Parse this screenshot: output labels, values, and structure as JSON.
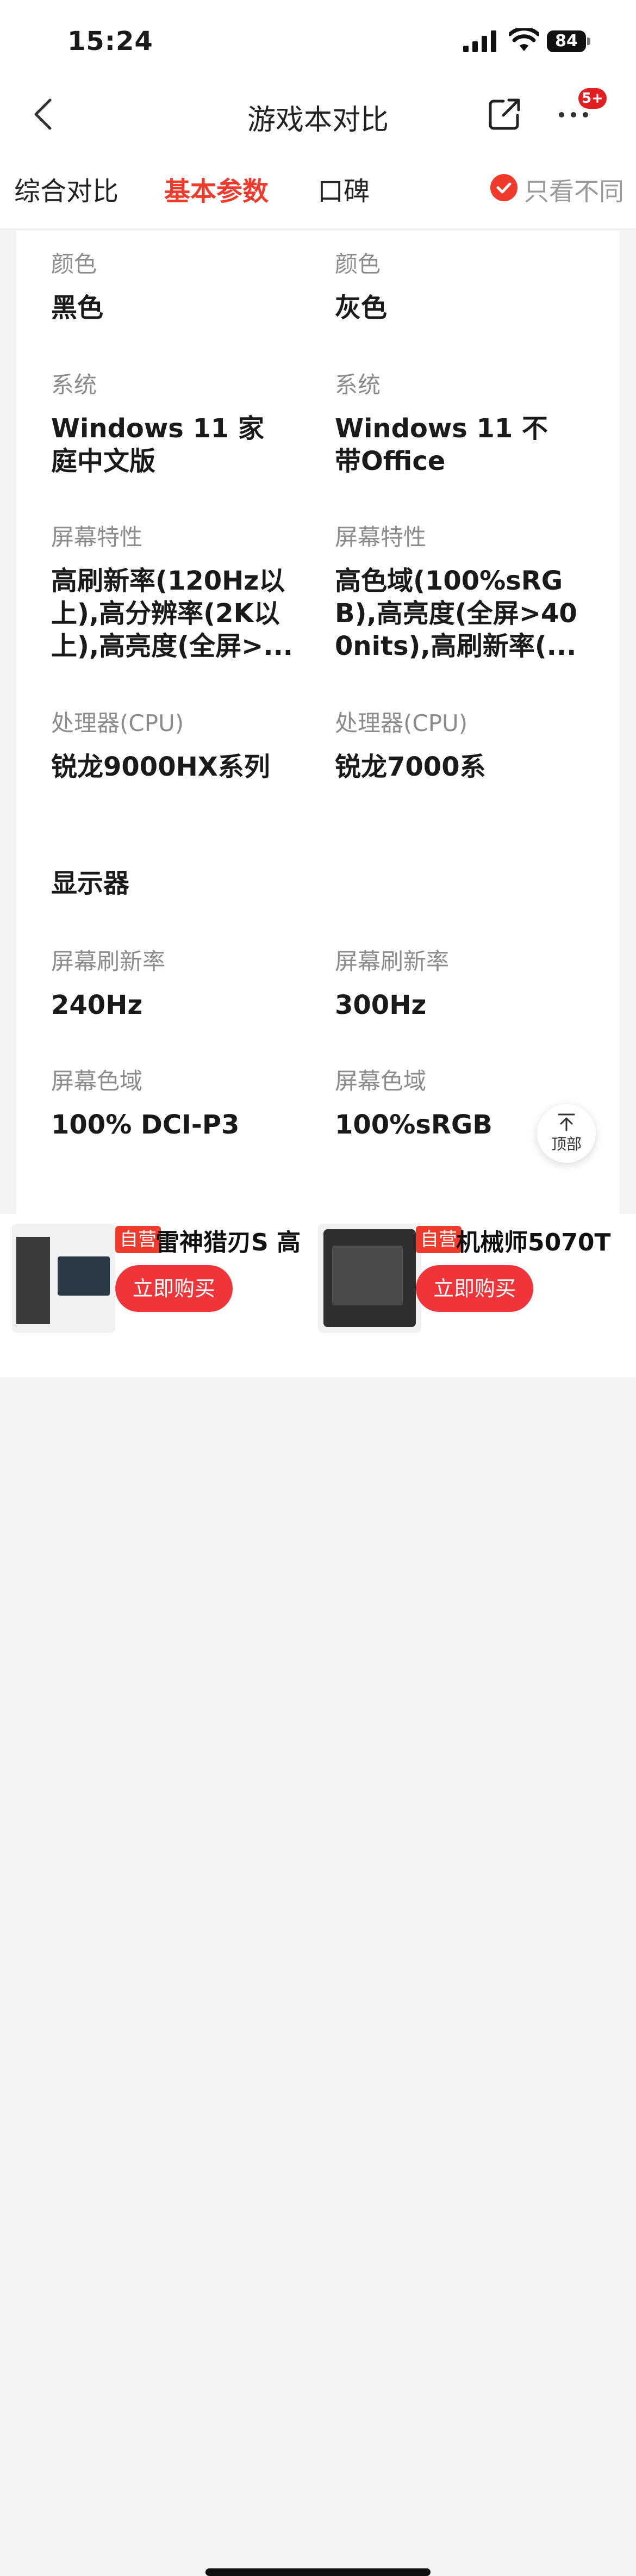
{
  "status_bar": {
    "time": "15:24",
    "battery": "84"
  },
  "nav": {
    "title": "游戏本对比",
    "badge": "5+"
  },
  "tabs": [
    {
      "label": "综合对比",
      "active": false
    },
    {
      "label": "基本参数",
      "active": true
    },
    {
      "label": "口碑",
      "active": false
    }
  ],
  "filter": {
    "label": "只看不同",
    "checked": true
  },
  "params": {
    "color": {
      "label": "颜色",
      "left": "黑色",
      "right": "灰色"
    },
    "system": {
      "label": "系统",
      "left": "Windows 11 家庭中文版",
      "right": "Windows 11 不带Office"
    },
    "screen_features": {
      "label": "屏幕特性",
      "left": "高刷新率(120Hz以上),高分辨率(2K以上),高亮度(全屏>...",
      "right": "高色域(100%sRGB),高亮度(全屏>400nits),高刷新率(..."
    },
    "cpu": {
      "label": "处理器(CPU)",
      "left": "锐龙9000HX系列",
      "right": "锐龙7000系"
    }
  },
  "display_section": {
    "title": "显示器",
    "refresh": {
      "label": "屏幕刷新率",
      "left": "240Hz",
      "right": "300Hz"
    },
    "gamut": {
      "label": "屏幕色域",
      "left": "100% DCI-P3",
      "right": "100%sRGB"
    }
  },
  "back_to_top": {
    "label": "顶部"
  },
  "products": [
    {
      "tag": "自营",
      "name": "雷神猎刃S 高",
      "button": "立即购买"
    },
    {
      "tag": "自营",
      "name": "机械师5070T",
      "button": "立即购买"
    }
  ],
  "colors": {
    "accent": "#f03a2b",
    "badge": "#e02020",
    "muted_text": "#8c8c8c"
  }
}
